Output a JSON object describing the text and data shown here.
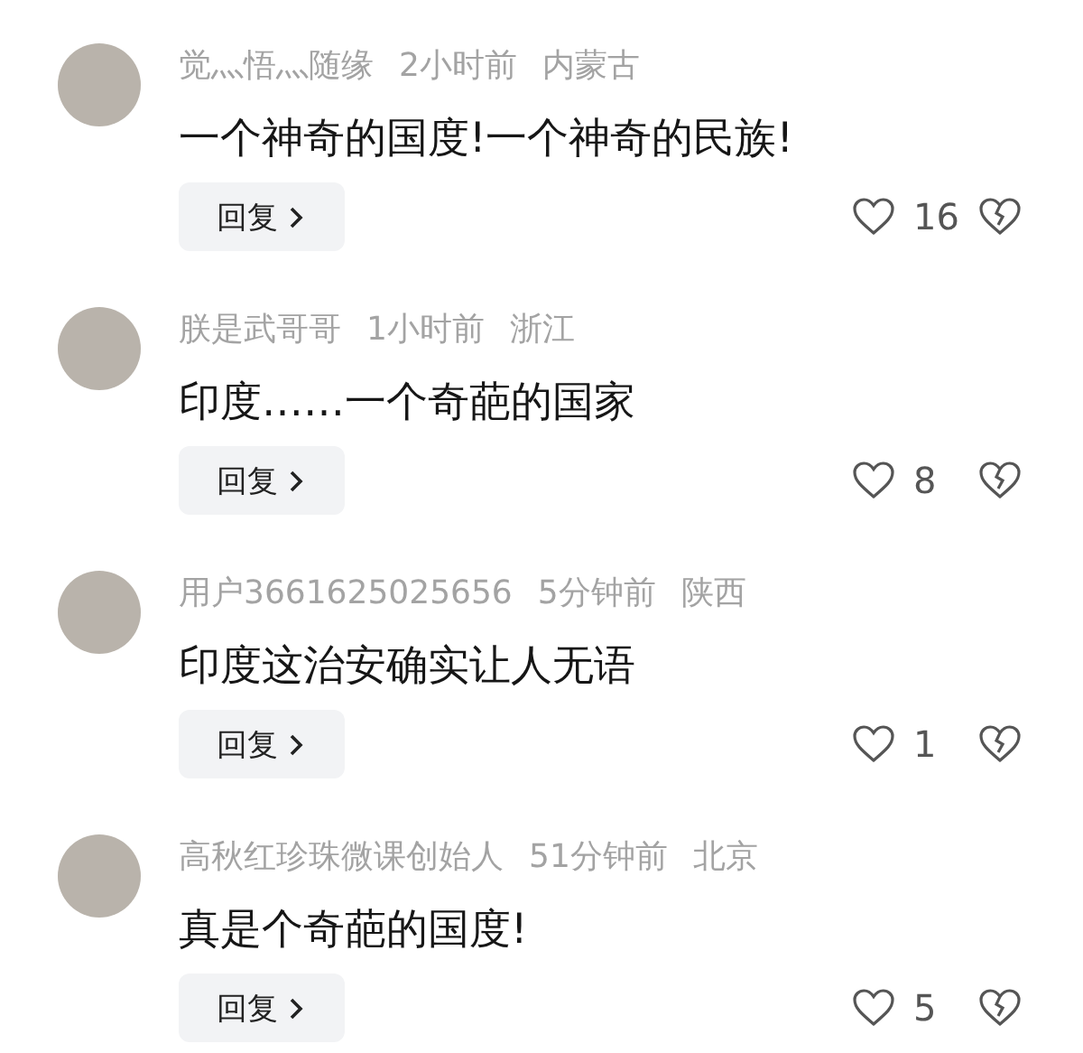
{
  "comments": [
    {
      "username": "觉灬悟灬随缘",
      "time": "2小时前",
      "location": "内蒙古",
      "text": "一个神奇的国度!一个神奇的民族!",
      "reply": "回复",
      "likes": "16"
    },
    {
      "username": "朕是武哥哥",
      "time": "1小时前",
      "location": "浙江",
      "text": "印度……一个奇葩的国家",
      "reply": "回复",
      "likes": "8"
    },
    {
      "username": "用户3661625025656",
      "time": "5分钟前",
      "location": "陕西",
      "text": "印度这治安确实让人无语",
      "reply": "回复",
      "likes": "1"
    },
    {
      "username": "高秋红珍珠微课创始人",
      "time": "51分钟前",
      "location": "北京",
      "text": "真是个奇葩的国度!",
      "reply": "回复",
      "likes": "5"
    }
  ]
}
